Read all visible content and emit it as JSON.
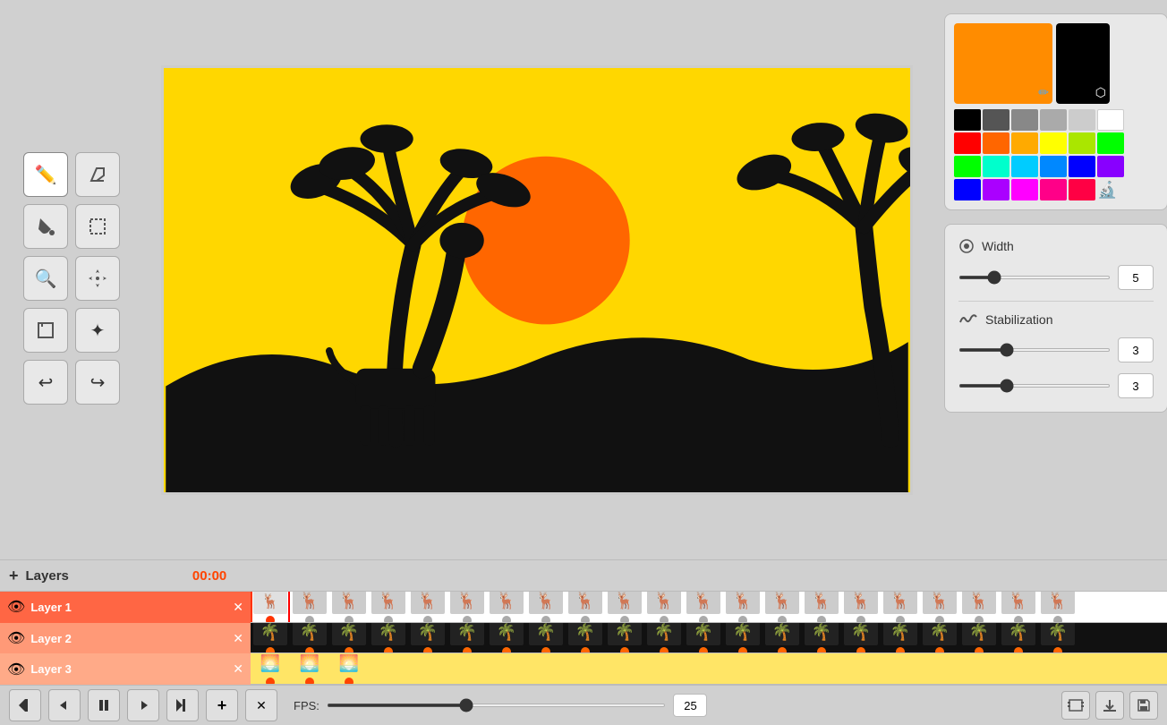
{
  "toolbar": {
    "tools": [
      {
        "id": "pencil",
        "icon": "✏️",
        "label": "Pencil"
      },
      {
        "id": "eraser",
        "icon": "◇",
        "label": "Eraser"
      },
      {
        "id": "fill",
        "icon": "🪣",
        "label": "Fill"
      },
      {
        "id": "select",
        "icon": "⬛",
        "label": "Select"
      },
      {
        "id": "zoom",
        "icon": "🔍",
        "label": "Zoom"
      },
      {
        "id": "move",
        "icon": "✛",
        "label": "Move"
      },
      {
        "id": "fullscreen",
        "icon": "⛶",
        "label": "Fullscreen"
      },
      {
        "id": "transform",
        "icon": "✦",
        "label": "Transform"
      },
      {
        "id": "undo",
        "icon": "↩",
        "label": "Undo"
      },
      {
        "id": "redo",
        "icon": "↪",
        "label": "Redo"
      }
    ]
  },
  "color_panel": {
    "primary_color": "#ff8c00",
    "secondary_color": "#000000",
    "swatches_row1": [
      "#000000",
      "#555555",
      "#888888",
      "#aaaaaa",
      "#cccccc",
      "#ffffff"
    ],
    "swatches_row2": [
      "#ff0000",
      "#ff6600",
      "#ffaa00",
      "#ffff00",
      "#aae600",
      "#00ff00"
    ],
    "swatches_row3": [
      "#00ff00",
      "#00ffcc",
      "#00ccff",
      "#0088ff",
      "#0000ff",
      "#8800ff"
    ],
    "swatches_row4": [
      "#0000ff",
      "#aa00ff",
      "#ff00ff",
      "#ff0088",
      "#ff0044",
      "eyedropper"
    ]
  },
  "stroke_panel": {
    "title": "Width",
    "width_value": "5",
    "stabilization_label": "Stabilization",
    "stabilization_value1": "3",
    "stabilization_value2": "3"
  },
  "layers": {
    "title": "Layers",
    "add_label": "+",
    "timecode": "00:00",
    "items": [
      {
        "name": "Layer 1",
        "visible": true,
        "active": true
      },
      {
        "name": "Layer 2",
        "visible": true,
        "active": false
      },
      {
        "name": "Layer 3",
        "visible": true,
        "active": false
      }
    ]
  },
  "playback": {
    "fps_label": "FPS:",
    "fps_value": "25",
    "btn_rewind": "⏮",
    "btn_prev": "◀",
    "btn_play": "⏸",
    "btn_next": "▶",
    "btn_fastforward": "⏭",
    "btn_add": "+",
    "btn_delete": "✕"
  }
}
